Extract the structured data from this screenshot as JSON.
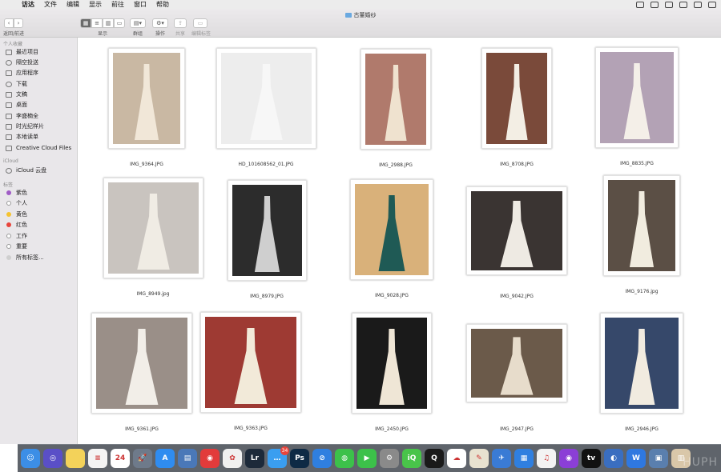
{
  "menubar": {
    "app": "访达",
    "items": [
      "文件",
      "编辑",
      "显示",
      "前往",
      "窗口",
      "帮助"
    ]
  },
  "window": {
    "title": "古董婚纱"
  },
  "toolbar": {
    "back_forward_label": "返回/前进",
    "view_label": "显示",
    "group_label": "群组",
    "action_label": "操作",
    "share_label": "共享",
    "tags_label": "编辑标签"
  },
  "sidebar": {
    "favorites_head": "个人收藏",
    "favorites": [
      "最近项目",
      "隔空投送",
      "应用程序",
      "下载",
      "文稿",
      "桌面",
      "李盛楠全",
      "时光纪样片",
      "本地读单",
      "Creative Cloud Files"
    ],
    "icloud_head": "iCloud",
    "icloud": [
      "iCloud 云盘"
    ],
    "tags_head": "标签",
    "tags": [
      {
        "label": "紫色",
        "color": "#a05cc6"
      },
      {
        "label": "个人",
        "color": "#ffffff"
      },
      {
        "label": "黄色",
        "color": "#f5c330"
      },
      {
        "label": "红色",
        "color": "#e8453c"
      },
      {
        "label": "工作",
        "color": "#ffffff"
      },
      {
        "label": "重要",
        "color": "#ffffff"
      },
      {
        "label": "所有标签...",
        "color": "#cfcfcf"
      }
    ]
  },
  "files": [
    {
      "name": "IMG_9364.JPG",
      "bg": "#c9b8a3",
      "fg": "#f1e7d8"
    },
    {
      "name": "HD_101608562_01.JPG",
      "bg": "#ededed",
      "fg": "#f7f7f7"
    },
    {
      "name": "IMG_2988.JPG",
      "bg": "#b07a6c",
      "fg": "#efe2cf"
    },
    {
      "name": "IMG_8708.JPG",
      "bg": "#7a4a3a",
      "fg": "#f3eee4"
    },
    {
      "name": "IMG_8835.JPG",
      "bg": "#b3a2b5",
      "fg": "#f4efe8"
    },
    {
      "name": "IMG_8949.jpg",
      "bg": "#c9c4bf",
      "fg": "#f0ece4"
    },
    {
      "name": "IMG_8979.JPG",
      "bg": "#2c2c2c",
      "fg": "#cfcfcf"
    },
    {
      "name": "IMG_9028.JPG",
      "bg": "#d9b17a",
      "fg": "#1f5a55"
    },
    {
      "name": "IMG_9042.JPG",
      "bg": "#3a3432",
      "fg": "#eeeae3"
    },
    {
      "name": "IMG_9176.jpg",
      "bg": "#5b4f45",
      "fg": "#f1ecdf"
    },
    {
      "name": "IMG_9361.JPG",
      "bg": "#9a8f88",
      "fg": "#f2eee8"
    },
    {
      "name": "IMG_9363.JPG",
      "bg": "#9e3a33",
      "fg": "#f2ead9"
    },
    {
      "name": "IMG_2450.JPG",
      "bg": "#1a1a1a",
      "fg": "#efe6d6"
    },
    {
      "name": "IMG_2947.JPG",
      "bg": "#6b5a4a",
      "fg": "#e7dccb"
    },
    {
      "name": "IMG_2946.JPG",
      "bg": "#36486a",
      "fg": "#f1ebe0"
    }
  ],
  "dock": [
    {
      "name": "finder",
      "color": "#3c8ee6",
      "glyph": "☺"
    },
    {
      "name": "siri",
      "color": "#5a4fc7",
      "glyph": "◎"
    },
    {
      "name": "notes",
      "color": "#f3d25a",
      "glyph": ""
    },
    {
      "name": "reminders",
      "color": "#f4f4f4",
      "glyph": "≡"
    },
    {
      "name": "calendar",
      "color": "#ffffff",
      "glyph": "24"
    },
    {
      "name": "launchpad",
      "color": "#6e7a8a",
      "glyph": "🚀"
    },
    {
      "name": "app-store",
      "color": "#2f8cf0",
      "glyph": "A"
    },
    {
      "name": "file-app",
      "color": "#4a78b8",
      "glyph": "▤"
    },
    {
      "name": "netease-music",
      "color": "#e23b3b",
      "glyph": "◉"
    },
    {
      "name": "photos",
      "color": "#f0f0f0",
      "glyph": "✿"
    },
    {
      "name": "lightroom",
      "color": "#1d2a3a",
      "glyph": "Lr"
    },
    {
      "name": "messages",
      "color": "#3a9ef0",
      "glyph": "…",
      "badge": "34"
    },
    {
      "name": "photoshop",
      "color": "#0e2a45",
      "glyph": "Ps"
    },
    {
      "name": "safari",
      "color": "#2f7fe0",
      "glyph": "⊘"
    },
    {
      "name": "wechat",
      "color": "#3cc14a",
      "glyph": "◍"
    },
    {
      "name": "facetime",
      "color": "#3cc14a",
      "glyph": "▶"
    },
    {
      "name": "system-preferences",
      "color": "#8a8a8a",
      "glyph": "⚙"
    },
    {
      "name": "iqiyi",
      "color": "#49c44a",
      "glyph": "iQ"
    },
    {
      "name": "qq",
      "color": "#1a1a1a",
      "glyph": "Q"
    },
    {
      "name": "baidu-netdisk",
      "color": "#ffffff",
      "glyph": "☁"
    },
    {
      "name": "preview",
      "color": "#e8e2d0",
      "glyph": "✎"
    },
    {
      "name": "pin-app",
      "color": "#3a7bd5",
      "glyph": "✈"
    },
    {
      "name": "keynote",
      "color": "#2f7fe0",
      "glyph": "▦"
    },
    {
      "name": "music",
      "color": "#f3f3f3",
      "glyph": "♫"
    },
    {
      "name": "podcasts",
      "color": "#8b3fd6",
      "glyph": "◉"
    },
    {
      "name": "apple-tv",
      "color": "#111111",
      "glyph": "tv"
    },
    {
      "name": "vpn",
      "color": "#3a6ec0",
      "glyph": "◐"
    },
    {
      "name": "word-app",
      "color": "#2f78e0",
      "glyph": "W"
    },
    {
      "name": "photo-slideshow",
      "color": "#5a7fae",
      "glyph": "▣"
    },
    {
      "name": "downloads-stack",
      "color": "#d9c7a9",
      "glyph": "▥"
    }
  ]
}
